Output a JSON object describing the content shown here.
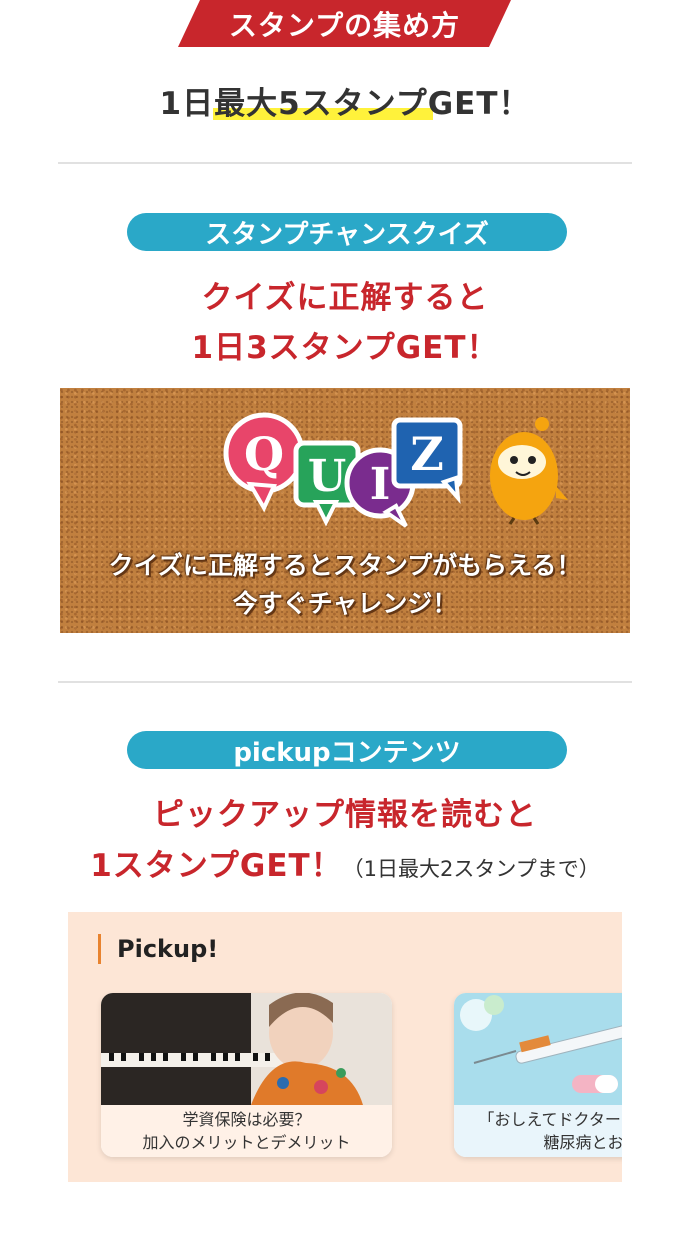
{
  "header": {
    "ribbon_title": "スタンプの集め方",
    "headline": "1日最大5スタンプGET！"
  },
  "quiz_section": {
    "pill_label": "スタンプチャンスクイズ",
    "line1": "クイズに正解すると",
    "line2": "1日3スタンプGET！",
    "banner": {
      "letters": [
        "Q",
        "U",
        "I",
        "Z"
      ],
      "text_line1": "クイズに正解するとスタンプがもらえる！",
      "text_line2": "今すぐチャレンジ！",
      "colors": {
        "q": "#e8456a",
        "u": "#27a35a",
        "i": "#7a2c8e",
        "z": "#1f63b0",
        "cork": "#c1803f",
        "mascot": "#f5a40f"
      }
    }
  },
  "pickup_section": {
    "pill_label": "pickupコンテンツ",
    "line1": "ピックアップ情報を読むと",
    "line2_main": "1スタンプGET！",
    "line2_note": "（1日最大2スタンプまで）",
    "panel_title": "Pickup!",
    "cards": [
      {
        "line1": "学資保険は必要？",
        "line2": "加入のメリットとデメリット"
      },
      {
        "line1": "「おしえてドクター 知っておきた",
        "line2": "糖尿病とお薬の"
      }
    ]
  },
  "colors": {
    "accent_red": "#c8262c",
    "pill_blue": "#2aa8c8",
    "highlight_yellow": "#fff23b",
    "pickup_bg": "#fde6d6"
  }
}
